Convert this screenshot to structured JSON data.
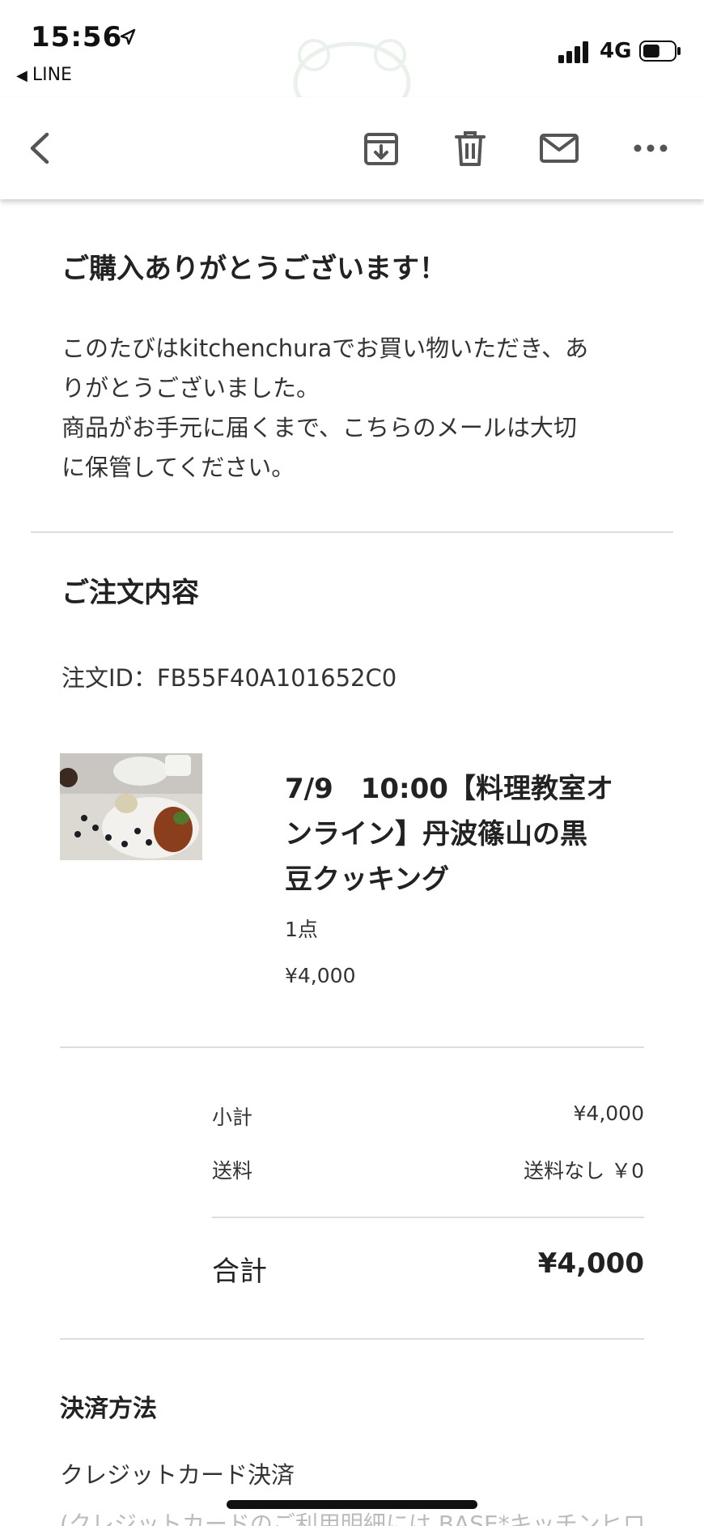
{
  "status_bar": {
    "time": "15:56",
    "back_app": "LINE",
    "network": "4G",
    "battery_level": 0.55,
    "signal_bars": 4
  },
  "email": {
    "thanks_title": "ご購入ありがとうございます！",
    "thanks_body_line1": "このたびはkitchenchuraでお買い物いただき、あ",
    "thanks_body_line2": "りがとうございました。",
    "thanks_body_line3": "商品がお手元に届くまで、こちらのメールは大切",
    "thanks_body_line4": "に保管してください。",
    "order_section_title": "ご注文内容",
    "order_id": "注文ID：FB55F40A101652C0",
    "item": {
      "name_line1": "7/9　10:00【料理教室オ",
      "name_line2": "ンライン】丹波篠山の黒",
      "name_line3": "豆クッキング",
      "quantity": "1点",
      "price": "¥4,000"
    },
    "summary": {
      "subtotal_label": "小計",
      "subtotal_value": "¥4,000",
      "shipping_label": "送料",
      "shipping_value": "送料なし ￥0",
      "total_label": "合計",
      "total_value": "¥4,000"
    },
    "payment": {
      "title": "決済方法",
      "method": "クレジットカード決済",
      "note": "(クレジットカードのご利用明細には BASE*キッチンヒロ"
    }
  },
  "toolbar_icons": [
    "back-arrow-icon",
    "archive-icon",
    "trash-icon",
    "mail-icon",
    "more-icon"
  ]
}
